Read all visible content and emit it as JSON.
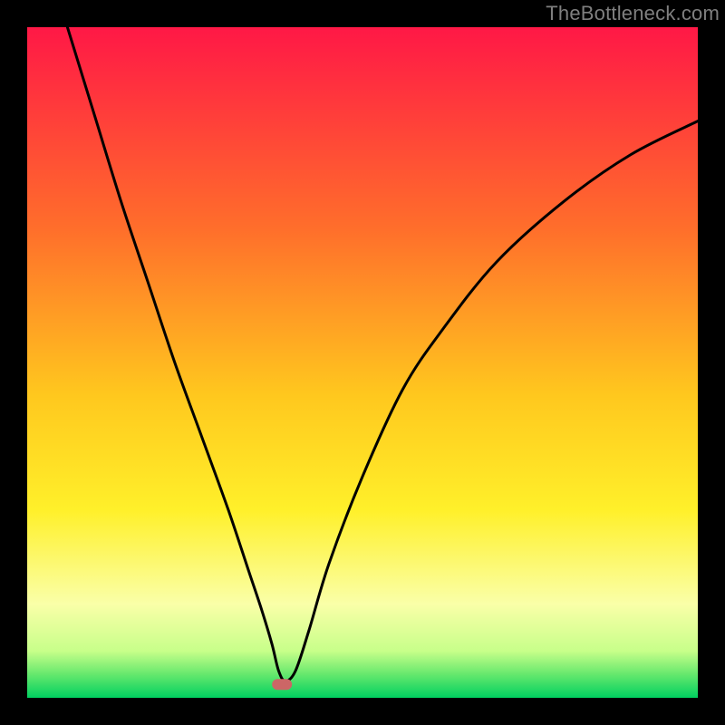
{
  "watermark": "TheBottleneck.com",
  "colors": {
    "page_bg": "#000000",
    "curve": "#000000",
    "marker_fill": "#cc6666",
    "gradient_stops": [
      {
        "offset": 0.0,
        "color": "#ff1846"
      },
      {
        "offset": 0.3,
        "color": "#ff6e2b"
      },
      {
        "offset": 0.55,
        "color": "#ffc81e"
      },
      {
        "offset": 0.72,
        "color": "#fff02a"
      },
      {
        "offset": 0.86,
        "color": "#faffa8"
      },
      {
        "offset": 0.93,
        "color": "#c8ff8a"
      },
      {
        "offset": 0.965,
        "color": "#66e86d"
      },
      {
        "offset": 1.0,
        "color": "#00d060"
      }
    ]
  },
  "chart_data": {
    "type": "line",
    "title": "",
    "xlabel": "",
    "ylabel": "",
    "xlim": [
      0,
      100
    ],
    "ylim": [
      0,
      100
    ],
    "grid": false,
    "legend": false,
    "marker": {
      "x": 38,
      "y": 2
    },
    "series": [
      {
        "name": "bottleneck-curve",
        "x": [
          6,
          10,
          14,
          18,
          22,
          26,
          30,
          33,
          35,
          36.5,
          37.5,
          38.5,
          40,
          42,
          45,
          50,
          56,
          62,
          70,
          80,
          90,
          100
        ],
        "values": [
          100,
          87,
          74,
          62,
          50,
          39,
          28,
          19,
          13,
          8,
          4,
          2.5,
          4,
          10,
          20,
          33,
          46,
          55,
          65,
          74,
          81,
          86
        ]
      }
    ]
  }
}
